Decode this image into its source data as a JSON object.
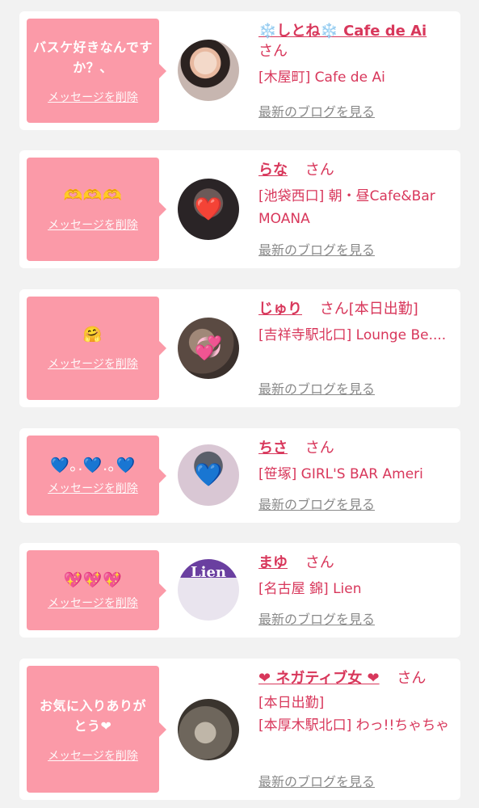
{
  "delete_label": "メッセージを削除",
  "blog_label": "最新のブログを見る",
  "colors": {
    "page_bg": "#f2f2f2",
    "card_bg": "#ffffff",
    "bubble_bg": "#fb9aa8",
    "accent": "#d8375b",
    "link_gray": "#8a8a8a"
  },
  "entries": [
    {
      "message": "バスケ好きなんですか？、",
      "name": "❄️しとね❄️ Cafe de Ai",
      "honorific": "さん",
      "status": "",
      "shop": "[木屋町] Cafe de Ai",
      "avatar_overlay": ""
    },
    {
      "message": "🫶🫶🫶",
      "name": "らな",
      "honorific": "さん",
      "status": "",
      "shop": "[池袋西口] 朝・昼Cafe&Bar MOANA",
      "avatar_overlay": "❤️"
    },
    {
      "message": "🤗",
      "name": "じゅり",
      "honorific": "さん",
      "status": "[本日出勤]",
      "shop": "[吉祥寺駅北口] Lounge Be....",
      "avatar_overlay": "💞"
    },
    {
      "message": "💙｡.💙.｡💙",
      "name": "ちさ",
      "honorific": "さん",
      "status": "",
      "shop": "[笹塚] GIRL'S BAR Ameri",
      "avatar_overlay": "💙"
    },
    {
      "message": "💖💖💖",
      "name": "まゆ",
      "honorific": "さん",
      "status": "",
      "shop": "[名古屋 錦] Lien",
      "avatar_overlay": "Lien"
    },
    {
      "message": "お気に入りありがとう❤",
      "name": "❤ ネガティブ女 ❤",
      "honorific": "さん",
      "status": "[本日出勤]",
      "shop": "[本厚木駅北口] わっ!!ちゃちゃ",
      "avatar_overlay": ""
    }
  ]
}
